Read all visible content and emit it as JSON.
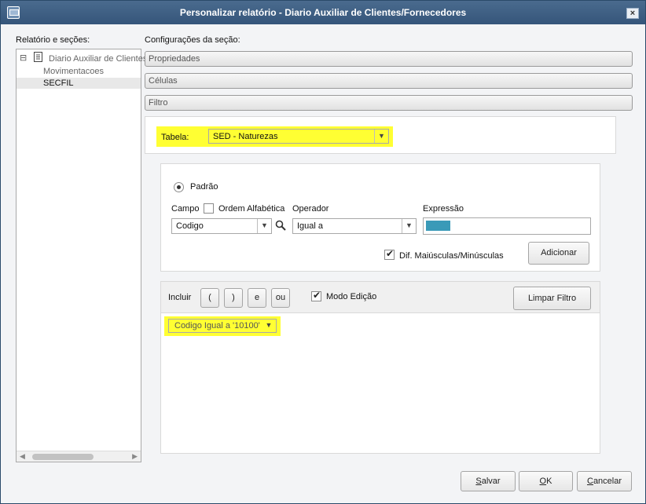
{
  "window": {
    "title": "Personalizar relatório - Diario Auxiliar de Clientes/Fornecedores",
    "close_glyph": "×"
  },
  "left": {
    "header": "Relatório e seções:",
    "tree": [
      {
        "label": "Diario Auxiliar de Clientes",
        "expander": "⊟"
      },
      {
        "label": "Movimentacoes"
      },
      {
        "label": "SECFIL",
        "selected": true
      }
    ],
    "scroll_left": "◀",
    "scroll_right": "▶"
  },
  "right": {
    "header": "Configurações da seção:",
    "sections": [
      "Propriedades",
      "Células",
      "Filtro"
    ]
  },
  "tabela": {
    "label": "Tabela:",
    "value": "SED - Naturezas"
  },
  "filtro": {
    "padrao_label": "Padrão",
    "campo_label": "Campo",
    "ordem_label": "Ordem Alfabética",
    "operador_label": "Operador",
    "expressao_label": "Expressão",
    "campo_value": "Codigo",
    "operador_value": "Igual a",
    "expressao_color": "#3a9ab8",
    "dif_label": "Dif. Maiúsculas/Minúsculas",
    "adicionar_label": "Adicionar"
  },
  "builder": {
    "incluir_label": "Incluir",
    "open_paren": "(",
    "close_paren": ")",
    "and_label": "e",
    "or_label": "ou",
    "modo_edicao_label": "Modo Edição",
    "limpar_label": "Limpar Filtro",
    "expression_value": "Codigo Igual a '10100'"
  },
  "footer": {
    "salvar_first": "S",
    "salvar_rest": "alvar",
    "ok_first": "O",
    "ok_rest": "K",
    "cancelar_first": "C",
    "cancelar_rest": "ancelar"
  },
  "colors": {
    "highlight": "#ffff33",
    "titlebar": "#3e6088"
  }
}
